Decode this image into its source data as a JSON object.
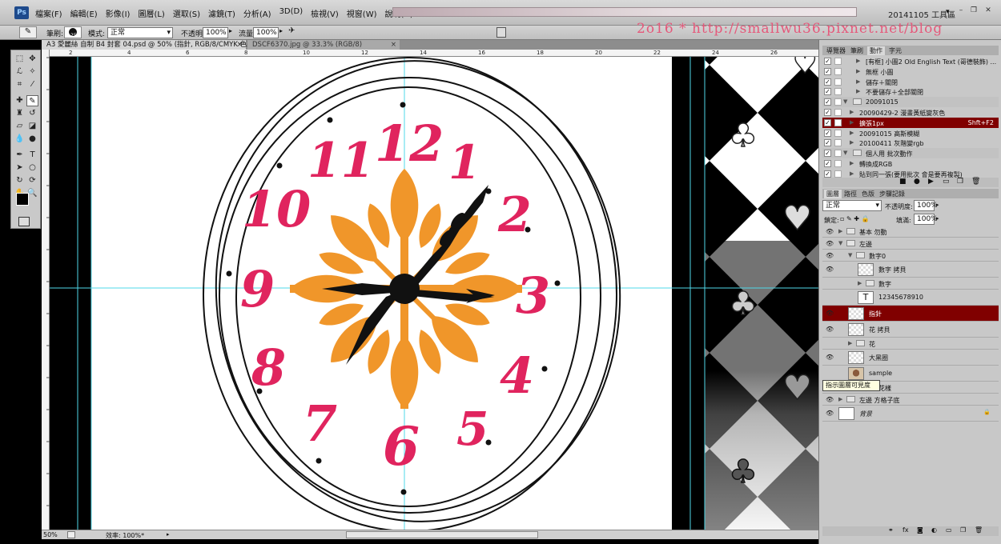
{
  "app": {
    "logo": "Ps",
    "menu": [
      "檔案(F)",
      "編輯(E)",
      "影像(I)",
      "圖層(L)",
      "選取(S)",
      "濾鏡(T)",
      "分析(A)",
      "3D(D)",
      "檢視(V)",
      "視窗(W)",
      "說明(H)"
    ],
    "workspace": "20141105 工具區"
  },
  "options": {
    "brush_label": "筆刷:",
    "brush_size": "25",
    "mode_label": "模式:",
    "mode_value": "正常",
    "opacity_label": "不透明:",
    "opacity_value": "100%",
    "flow_label": "流量:",
    "flow_value": "100%"
  },
  "watermark": "2o16 * http://smallwu36.pixnet.net/blog",
  "tabs": [
    {
      "label": "A3 愛麗絲 自制 B4 封套 04.psd @ 50% (指針, RGB/8/CMYK 色彩) *",
      "active": true
    },
    {
      "label": "DSCF6370.jpg @ 33.3% (RGB/8)",
      "active": false
    }
  ],
  "ruler_h": [
    "2",
    "4",
    "6",
    "8",
    "10",
    "12",
    "14",
    "16",
    "18",
    "20",
    "22",
    "24",
    "26"
  ],
  "clock": {
    "numerals": [
      "12",
      "1",
      "2",
      "3",
      "4",
      "5",
      "6",
      "7",
      "8",
      "9",
      "10",
      "11"
    ],
    "numeral_color": "#e0245e",
    "flower_color": "#f0962a"
  },
  "status": {
    "zoom": "50%",
    "efficiency": "效率: 100%*"
  },
  "actions_panel": {
    "tabs": [
      "導覽器",
      "筆刷",
      "動作",
      "字元"
    ],
    "active_tab": "動作",
    "items": [
      {
        "label": "[有框] 小圖2 Old English Text (哥德裝飾) ...",
        "indent": 3,
        "checked": true,
        "selected": false,
        "shortcut": ""
      },
      {
        "label": "無框 小圖",
        "indent": 3,
        "checked": true,
        "selected": false,
        "shortcut": ""
      },
      {
        "label": "儲存＋關閉",
        "indent": 3,
        "checked": true,
        "selected": false,
        "shortcut": ""
      },
      {
        "label": "不要儲存＋全部關閉",
        "indent": 3,
        "checked": true,
        "selected": false,
        "shortcut": ""
      },
      {
        "label": "20091015",
        "indent": 1,
        "checked": true,
        "selected": false,
        "shortcut": "",
        "folder": true
      },
      {
        "label": "20090429-2 漫畫黃紙變灰色",
        "indent": 2,
        "checked": true,
        "selected": false,
        "shortcut": ""
      },
      {
        "label": "擴張1px",
        "indent": 2,
        "checked": true,
        "selected": true,
        "shortcut": "Shft+F2"
      },
      {
        "label": "20091015 高斯模糊",
        "indent": 2,
        "checked": true,
        "selected": false,
        "shortcut": ""
      },
      {
        "label": "20100411 灰階變rgb",
        "indent": 2,
        "checked": true,
        "selected": false,
        "shortcut": ""
      },
      {
        "label": "個人用 批次動作",
        "indent": 1,
        "checked": true,
        "selected": false,
        "shortcut": "",
        "folder": true
      },
      {
        "label": "轉換成RGB",
        "indent": 2,
        "checked": true,
        "selected": false,
        "shortcut": ""
      },
      {
        "label": "貼到同一張(要用批次 會是要再複製)",
        "indent": 2,
        "checked": true,
        "selected": false,
        "shortcut": ""
      }
    ]
  },
  "layers_panel": {
    "tabs": [
      "圖層",
      "路徑",
      "色版",
      "步驟記錄"
    ],
    "active_tab": "圖層",
    "blend_mode": "正常",
    "opacity_label": "不透明度:",
    "opacity_value": "100%",
    "lock_label": "鎖定:",
    "fill_label": "填滿:",
    "fill_value": "100%",
    "tooltip": "指示圖層可見度",
    "layers": [
      {
        "name": "基本 勿動",
        "type": "group",
        "indent": 0,
        "visible": true,
        "selected": false
      },
      {
        "name": "左邊",
        "type": "group",
        "indent": 0,
        "visible": true,
        "selected": false,
        "open": true
      },
      {
        "name": "數字0",
        "type": "group",
        "indent": 1,
        "visible": true,
        "selected": false,
        "open": true
      },
      {
        "name": "數字 拷貝",
        "type": "pixel",
        "indent": 2,
        "visible": true,
        "selected": false
      },
      {
        "name": "數字",
        "type": "group",
        "indent": 2,
        "visible": false,
        "selected": false
      },
      {
        "name": "12345678910",
        "type": "text",
        "indent": 2,
        "visible": false,
        "selected": false
      },
      {
        "name": "指針",
        "type": "pixel",
        "indent": 1,
        "visible": true,
        "selected": true
      },
      {
        "name": "花 拷貝",
        "type": "pixel",
        "indent": 1,
        "visible": true,
        "selected": false
      },
      {
        "name": "花",
        "type": "group",
        "indent": 1,
        "visible": false,
        "selected": false
      },
      {
        "name": "大黑圈",
        "type": "pixel",
        "indent": 1,
        "visible": true,
        "selected": false
      },
      {
        "name": "sample",
        "type": "image",
        "indent": 1,
        "visible": false,
        "selected": false
      },
      {
        "name": "撲克牌花樣",
        "type": "group",
        "indent": 0,
        "visible": true,
        "selected": false
      },
      {
        "name": "左邊 方格子底",
        "type": "group",
        "indent": 0,
        "visible": true,
        "selected": false
      },
      {
        "name": "背景",
        "type": "background",
        "indent": 0,
        "visible": true,
        "selected": false
      }
    ]
  },
  "colors": {
    "selection": "#800000",
    "panel_bg": "#c8c8c8",
    "guide": "#4fd8e8"
  }
}
